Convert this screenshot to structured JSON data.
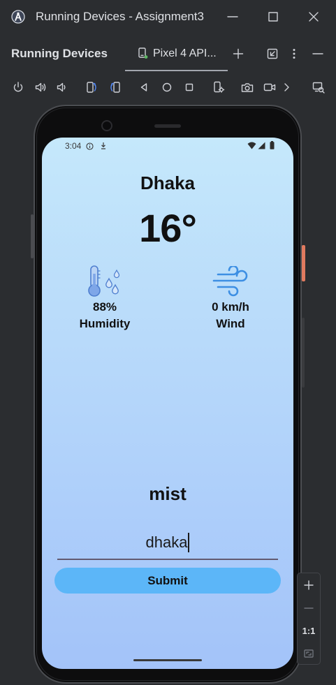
{
  "window": {
    "title": "Running Devices - Assignment3",
    "app_icon": "android-studio-icon",
    "controls": [
      "minimize-icon",
      "maximize-icon",
      "close-icon"
    ]
  },
  "tool_window": {
    "title": "Running Devices",
    "tab": {
      "label": "Pixel 4 API...",
      "icon": "device-icon"
    },
    "actions": [
      "add-tab-icon",
      "restore-icon",
      "more-vertical-icon",
      "hide-icon"
    ]
  },
  "device_toolbar": {
    "actions": [
      "power-icon",
      "volume-up-icon",
      "volume-down-icon",
      "rotate-left-icon",
      "rotate-right-icon",
      "back-icon",
      "home-icon",
      "overview-icon",
      "device-settings-icon",
      "screenshot-icon",
      "screen-record-icon",
      "chevron-right-icon",
      "layout-inspector-icon"
    ]
  },
  "device": {
    "status_bar": {
      "time": "3:04",
      "left_icons": [
        "info-icon",
        "download-icon"
      ],
      "right_icons": [
        "wifi-icon",
        "cell-signal-icon",
        "battery-icon"
      ]
    },
    "weather_app": {
      "city": "Dhaka",
      "temperature": "16°",
      "humidity": {
        "icon": "humidity-icon",
        "value": "88%",
        "label": "Humidity"
      },
      "wind": {
        "icon": "wind-icon",
        "value": "0 km/h",
        "label": "Wind"
      },
      "condition": "mist",
      "city_input": {
        "value": "dhaka"
      },
      "submit_button": {
        "label": "Submit"
      }
    }
  },
  "zoom_controls": {
    "zoom_in": "zoom-in-icon",
    "zoom_out": "zoom-out-icon",
    "actual_size_label": "1:1",
    "fit_to_window": "fit-screen-icon"
  },
  "colors": {
    "ide_background": "#2b2d30",
    "ide_text": "#dfe1e5",
    "ide_icon": "#ced0d6",
    "ide_icon_disabled": "#6f737a",
    "accent": "#548af7",
    "tab_underline": "#a2a6ae",
    "screen_top": "#c5e8fb",
    "screen_bottom": "#a3c3f9",
    "app_text": "#111111",
    "submit_button": "#5cb6f8",
    "input_underline": "#625b71",
    "hardware_button": "#e07a5f",
    "wind_icon": "#3d8fe3",
    "humidity_icon": "#4f7fcf"
  }
}
